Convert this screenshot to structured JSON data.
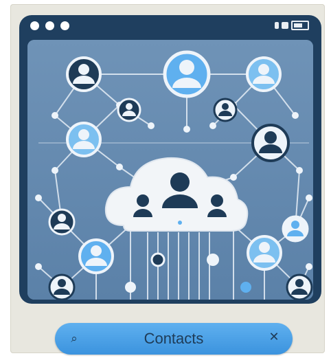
{
  "search_bar": {
    "label": "Contacts",
    "left_icon": "user-search-icon",
    "right_icon": "close-icon"
  },
  "colors": {
    "window": "#1f3f5f",
    "canvas": "#6b8db0",
    "node_line": "#e6eef6",
    "accent_blue": "#5fb0ef",
    "dark_user": "#1e3b57"
  },
  "window": {
    "traffic_lights": [
      "dot",
      "dot",
      "dot"
    ],
    "status_icons": [
      "signal-icon",
      "wifi-icon",
      "battery-icon"
    ]
  }
}
